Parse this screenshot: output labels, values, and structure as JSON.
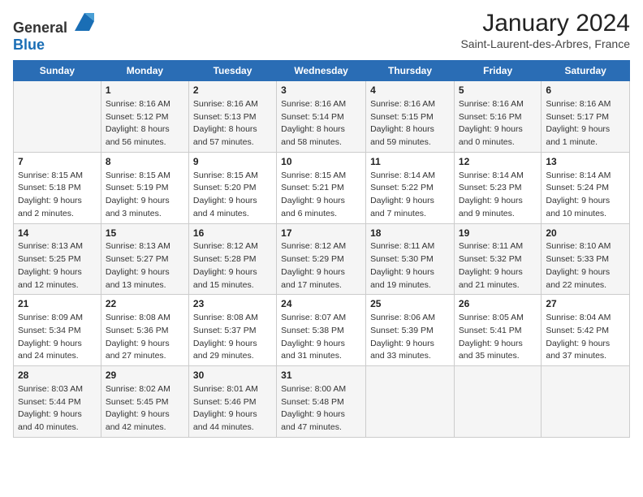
{
  "header": {
    "logo_general": "General",
    "logo_blue": "Blue",
    "month_title": "January 2024",
    "location": "Saint-Laurent-des-Arbres, France"
  },
  "days_of_week": [
    "Sunday",
    "Monday",
    "Tuesday",
    "Wednesday",
    "Thursday",
    "Friday",
    "Saturday"
  ],
  "weeks": [
    [
      {
        "day": "",
        "sunrise": "",
        "sunset": "",
        "daylight": ""
      },
      {
        "day": "1",
        "sunrise": "Sunrise: 8:16 AM",
        "sunset": "Sunset: 5:12 PM",
        "daylight": "Daylight: 8 hours and 56 minutes."
      },
      {
        "day": "2",
        "sunrise": "Sunrise: 8:16 AM",
        "sunset": "Sunset: 5:13 PM",
        "daylight": "Daylight: 8 hours and 57 minutes."
      },
      {
        "day": "3",
        "sunrise": "Sunrise: 8:16 AM",
        "sunset": "Sunset: 5:14 PM",
        "daylight": "Daylight: 8 hours and 58 minutes."
      },
      {
        "day": "4",
        "sunrise": "Sunrise: 8:16 AM",
        "sunset": "Sunset: 5:15 PM",
        "daylight": "Daylight: 8 hours and 59 minutes."
      },
      {
        "day": "5",
        "sunrise": "Sunrise: 8:16 AM",
        "sunset": "Sunset: 5:16 PM",
        "daylight": "Daylight: 9 hours and 0 minutes."
      },
      {
        "day": "6",
        "sunrise": "Sunrise: 8:16 AM",
        "sunset": "Sunset: 5:17 PM",
        "daylight": "Daylight: 9 hours and 1 minute."
      }
    ],
    [
      {
        "day": "7",
        "sunrise": "Sunrise: 8:15 AM",
        "sunset": "Sunset: 5:18 PM",
        "daylight": "Daylight: 9 hours and 2 minutes."
      },
      {
        "day": "8",
        "sunrise": "Sunrise: 8:15 AM",
        "sunset": "Sunset: 5:19 PM",
        "daylight": "Daylight: 9 hours and 3 minutes."
      },
      {
        "day": "9",
        "sunrise": "Sunrise: 8:15 AM",
        "sunset": "Sunset: 5:20 PM",
        "daylight": "Daylight: 9 hours and 4 minutes."
      },
      {
        "day": "10",
        "sunrise": "Sunrise: 8:15 AM",
        "sunset": "Sunset: 5:21 PM",
        "daylight": "Daylight: 9 hours and 6 minutes."
      },
      {
        "day": "11",
        "sunrise": "Sunrise: 8:14 AM",
        "sunset": "Sunset: 5:22 PM",
        "daylight": "Daylight: 9 hours and 7 minutes."
      },
      {
        "day": "12",
        "sunrise": "Sunrise: 8:14 AM",
        "sunset": "Sunset: 5:23 PM",
        "daylight": "Daylight: 9 hours and 9 minutes."
      },
      {
        "day": "13",
        "sunrise": "Sunrise: 8:14 AM",
        "sunset": "Sunset: 5:24 PM",
        "daylight": "Daylight: 9 hours and 10 minutes."
      }
    ],
    [
      {
        "day": "14",
        "sunrise": "Sunrise: 8:13 AM",
        "sunset": "Sunset: 5:25 PM",
        "daylight": "Daylight: 9 hours and 12 minutes."
      },
      {
        "day": "15",
        "sunrise": "Sunrise: 8:13 AM",
        "sunset": "Sunset: 5:27 PM",
        "daylight": "Daylight: 9 hours and 13 minutes."
      },
      {
        "day": "16",
        "sunrise": "Sunrise: 8:12 AM",
        "sunset": "Sunset: 5:28 PM",
        "daylight": "Daylight: 9 hours and 15 minutes."
      },
      {
        "day": "17",
        "sunrise": "Sunrise: 8:12 AM",
        "sunset": "Sunset: 5:29 PM",
        "daylight": "Daylight: 9 hours and 17 minutes."
      },
      {
        "day": "18",
        "sunrise": "Sunrise: 8:11 AM",
        "sunset": "Sunset: 5:30 PM",
        "daylight": "Daylight: 9 hours and 19 minutes."
      },
      {
        "day": "19",
        "sunrise": "Sunrise: 8:11 AM",
        "sunset": "Sunset: 5:32 PM",
        "daylight": "Daylight: 9 hours and 21 minutes."
      },
      {
        "day": "20",
        "sunrise": "Sunrise: 8:10 AM",
        "sunset": "Sunset: 5:33 PM",
        "daylight": "Daylight: 9 hours and 22 minutes."
      }
    ],
    [
      {
        "day": "21",
        "sunrise": "Sunrise: 8:09 AM",
        "sunset": "Sunset: 5:34 PM",
        "daylight": "Daylight: 9 hours and 24 minutes."
      },
      {
        "day": "22",
        "sunrise": "Sunrise: 8:08 AM",
        "sunset": "Sunset: 5:36 PM",
        "daylight": "Daylight: 9 hours and 27 minutes."
      },
      {
        "day": "23",
        "sunrise": "Sunrise: 8:08 AM",
        "sunset": "Sunset: 5:37 PM",
        "daylight": "Daylight: 9 hours and 29 minutes."
      },
      {
        "day": "24",
        "sunrise": "Sunrise: 8:07 AM",
        "sunset": "Sunset: 5:38 PM",
        "daylight": "Daylight: 9 hours and 31 minutes."
      },
      {
        "day": "25",
        "sunrise": "Sunrise: 8:06 AM",
        "sunset": "Sunset: 5:39 PM",
        "daylight": "Daylight: 9 hours and 33 minutes."
      },
      {
        "day": "26",
        "sunrise": "Sunrise: 8:05 AM",
        "sunset": "Sunset: 5:41 PM",
        "daylight": "Daylight: 9 hours and 35 minutes."
      },
      {
        "day": "27",
        "sunrise": "Sunrise: 8:04 AM",
        "sunset": "Sunset: 5:42 PM",
        "daylight": "Daylight: 9 hours and 37 minutes."
      }
    ],
    [
      {
        "day": "28",
        "sunrise": "Sunrise: 8:03 AM",
        "sunset": "Sunset: 5:44 PM",
        "daylight": "Daylight: 9 hours and 40 minutes."
      },
      {
        "day": "29",
        "sunrise": "Sunrise: 8:02 AM",
        "sunset": "Sunset: 5:45 PM",
        "daylight": "Daylight: 9 hours and 42 minutes."
      },
      {
        "day": "30",
        "sunrise": "Sunrise: 8:01 AM",
        "sunset": "Sunset: 5:46 PM",
        "daylight": "Daylight: 9 hours and 44 minutes."
      },
      {
        "day": "31",
        "sunrise": "Sunrise: 8:00 AM",
        "sunset": "Sunset: 5:48 PM",
        "daylight": "Daylight: 9 hours and 47 minutes."
      },
      {
        "day": "",
        "sunrise": "",
        "sunset": "",
        "daylight": ""
      },
      {
        "day": "",
        "sunrise": "",
        "sunset": "",
        "daylight": ""
      },
      {
        "day": "",
        "sunrise": "",
        "sunset": "",
        "daylight": ""
      }
    ]
  ]
}
